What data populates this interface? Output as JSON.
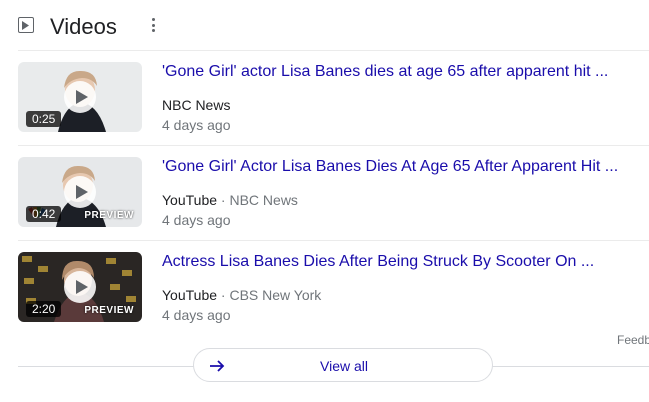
{
  "section": {
    "title": "Videos",
    "icon": "play-box-icon",
    "menu_icon": "kebab-menu-icon"
  },
  "videos": [
    {
      "title": "'Gone Girl' actor Lisa Banes dies at age 65 after apparent hit ...",
      "source": "NBC News",
      "channel": "",
      "age": "4 days ago",
      "duration": "0:25",
      "preview": ""
    },
    {
      "title": "'Gone Girl' Actor Lisa Banes Dies At Age 65 After Apparent Hit ...",
      "source": "YouTube",
      "separator": "·",
      "channel": "NBC News",
      "age": "4 days ago",
      "duration": "0:42",
      "preview": "PREVIEW"
    },
    {
      "title": "Actress Lisa Banes Dies After Being Struck By Scooter On ...",
      "source": "YouTube",
      "separator": "·",
      "channel": "CBS New York",
      "age": "4 days ago",
      "duration": "2:20",
      "preview": "PREVIEW"
    }
  ],
  "feedback_label": "Feedb",
  "view_all": {
    "label": "View all",
    "icon": "arrow-right-icon"
  },
  "colors": {
    "link": "#1a0dab",
    "meta": "#70757a",
    "text": "#202124"
  }
}
